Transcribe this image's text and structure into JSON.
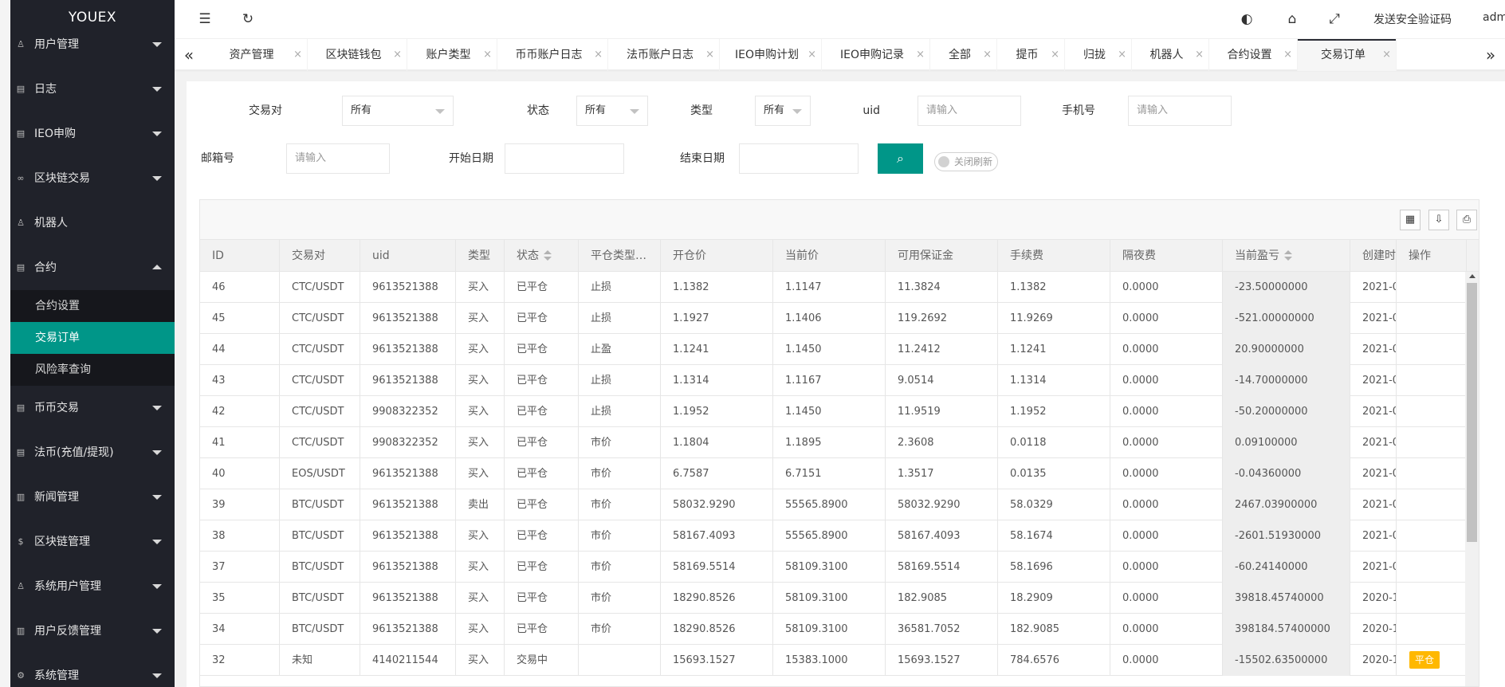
{
  "sidebar": {
    "logo": "YOUEX",
    "items": [
      {
        "label": "用户管理",
        "icon": "user-icon",
        "glyph": "♙",
        "caret": "down"
      },
      {
        "label": "日志",
        "icon": "log-icon",
        "glyph": "▤",
        "caret": "down"
      },
      {
        "label": "IEO申购",
        "icon": "ieo-icon",
        "glyph": "▤",
        "caret": "down"
      },
      {
        "label": "区块链交易",
        "icon": "link-icon",
        "glyph": "∞",
        "caret": "down"
      },
      {
        "label": "机器人",
        "icon": "robot-icon",
        "glyph": "♙",
        "caret": "none"
      },
      {
        "label": "合约",
        "icon": "contract-icon",
        "glyph": "▤",
        "caret": "up"
      }
    ],
    "sub_items": [
      {
        "label": "合约设置",
        "active": false
      },
      {
        "label": "交易订单",
        "active": true
      },
      {
        "label": "风险率查询",
        "active": false
      }
    ],
    "items_after": [
      {
        "label": "币币交易",
        "icon": "coin-icon",
        "glyph": "▤",
        "caret": "down"
      },
      {
        "label": "法币(充值/提现)",
        "icon": "fiat-icon",
        "glyph": "▤",
        "caret": "down"
      },
      {
        "label": "新闻管理",
        "icon": "news-icon",
        "glyph": "▥",
        "caret": "down"
      },
      {
        "label": "区块链管理",
        "icon": "chain-icon",
        "glyph": "$",
        "caret": "down"
      },
      {
        "label": "系统用户管理",
        "icon": "sysuser-icon",
        "glyph": "♙",
        "caret": "down"
      },
      {
        "label": "用户反馈管理",
        "icon": "feedback-icon",
        "glyph": "▥",
        "caret": "down"
      },
      {
        "label": "系统管理",
        "icon": "settings-icon",
        "glyph": "⚙",
        "caret": "down"
      }
    ]
  },
  "header": {
    "menu_icon": "☰",
    "refresh_icon": "↻",
    "theme_icon": "◐",
    "tag_icon": "⌂",
    "fullscreen_icon": "⤢",
    "send_code_label": "发送安全验证码",
    "user_label": "admin"
  },
  "tabs": {
    "prev_glyph": "«",
    "next_glyph": "»",
    "close_glyph": "×",
    "items": [
      {
        "label": "资产管理",
        "active": false
      },
      {
        "label": "区块链钱包",
        "active": false
      },
      {
        "label": "账户类型",
        "active": false
      },
      {
        "label": "币币账户日志",
        "active": false
      },
      {
        "label": "法币账户日志",
        "active": false
      },
      {
        "label": "IEO申购计划",
        "active": false
      },
      {
        "label": "IEO申购记录",
        "active": false
      },
      {
        "label": "全部",
        "active": false
      },
      {
        "label": "提币",
        "active": false
      },
      {
        "label": "归拢",
        "active": false
      },
      {
        "label": "机器人",
        "active": false
      },
      {
        "label": "合约设置",
        "active": false
      },
      {
        "label": "交易订单",
        "active": true
      }
    ]
  },
  "filters": {
    "pair_label": "交易对",
    "pair_value": "所有",
    "status_label": "状态",
    "status_value": "所有",
    "type_label": "类型",
    "type_value": "所有",
    "uid_label": "uid",
    "uid_placeholder": "请输入",
    "phone_label": "手机号",
    "phone_placeholder": "请输入",
    "email_label": "邮箱号",
    "email_placeholder": "请输入",
    "start_label": "开始日期",
    "end_label": "结束日期",
    "search_glyph": "⌕",
    "refresh_switch_label": "关闭刷新"
  },
  "toolbar": {
    "columns_glyph": "▦",
    "export_glyph": "⇩",
    "print_glyph": "⎙"
  },
  "table": {
    "columns": [
      {
        "label": "ID",
        "sortable": false
      },
      {
        "label": "交易对",
        "sortable": false
      },
      {
        "label": "uid",
        "sortable": false
      },
      {
        "label": "类型",
        "sortable": false
      },
      {
        "label": "状态",
        "sortable": true
      },
      {
        "label": "平仓类型…",
        "sortable": false
      },
      {
        "label": "开仓价",
        "sortable": false
      },
      {
        "label": "当前价",
        "sortable": false
      },
      {
        "label": "可用保证金",
        "sortable": false
      },
      {
        "label": "手续费",
        "sortable": false
      },
      {
        "label": "隔夜费",
        "sortable": false
      },
      {
        "label": "当前盈亏",
        "sortable": true
      },
      {
        "label": "创建时间",
        "sortable": false
      },
      {
        "label": "操作",
        "sortable": false
      }
    ],
    "action_label": "平仓",
    "rows": [
      [
        "46",
        "CTC/USDT",
        "9613521388",
        "买入",
        "已平仓",
        "止损",
        "1.1382",
        "1.1147",
        "11.3824",
        "1.1382",
        "0.0000",
        "-23.50000000",
        "2021-0",
        ""
      ],
      [
        "45",
        "CTC/USDT",
        "9613521388",
        "买入",
        "已平仓",
        "止损",
        "1.1927",
        "1.1406",
        "119.2692",
        "11.9269",
        "0.0000",
        "-521.00000000",
        "2021-0",
        ""
      ],
      [
        "44",
        "CTC/USDT",
        "9613521388",
        "买入",
        "已平仓",
        "止盈",
        "1.1241",
        "1.1450",
        "11.2412",
        "1.1241",
        "0.0000",
        "20.90000000",
        "2021-0",
        ""
      ],
      [
        "43",
        "CTC/USDT",
        "9613521388",
        "买入",
        "已平仓",
        "止损",
        "1.1314",
        "1.1167",
        "9.0514",
        "1.1314",
        "0.0000",
        "-14.70000000",
        "2021-0",
        ""
      ],
      [
        "42",
        "CTC/USDT",
        "9908322352",
        "买入",
        "已平仓",
        "止损",
        "1.1952",
        "1.1450",
        "11.9519",
        "1.1952",
        "0.0000",
        "-50.20000000",
        "2021-0",
        ""
      ],
      [
        "41",
        "CTC/USDT",
        "9908322352",
        "买入",
        "已平仓",
        "市价",
        "1.1804",
        "1.1895",
        "2.3608",
        "0.0118",
        "0.0000",
        "0.09100000",
        "2021-0",
        ""
      ],
      [
        "40",
        "EOS/USDT",
        "9613521388",
        "买入",
        "已平仓",
        "市价",
        "6.7587",
        "6.7151",
        "1.3517",
        "0.0135",
        "0.0000",
        "-0.04360000",
        "2021-0",
        ""
      ],
      [
        "39",
        "BTC/USDT",
        "9613521388",
        "卖出",
        "已平仓",
        "市价",
        "58032.9290",
        "55565.8900",
        "58032.9290",
        "58.0329",
        "0.0000",
        "2467.03900000",
        "2021-0",
        ""
      ],
      [
        "38",
        "BTC/USDT",
        "9613521388",
        "买入",
        "已平仓",
        "市价",
        "58167.4093",
        "55565.8900",
        "58167.4093",
        "58.1674",
        "0.0000",
        "-2601.51930000",
        "2021-0",
        ""
      ],
      [
        "37",
        "BTC/USDT",
        "9613521388",
        "买入",
        "已平仓",
        "市价",
        "58169.5514",
        "58109.3100",
        "58169.5514",
        "58.1696",
        "0.0000",
        "-60.24140000",
        "2021-0",
        ""
      ],
      [
        "35",
        "BTC/USDT",
        "9613521388",
        "买入",
        "已平仓",
        "市价",
        "18290.8526",
        "58109.3100",
        "182.9085",
        "18.2909",
        "0.0000",
        "39818.45740000",
        "2020-1",
        ""
      ],
      [
        "34",
        "BTC/USDT",
        "9613521388",
        "买入",
        "已平仓",
        "市价",
        "18290.8526",
        "58109.3100",
        "36581.7052",
        "182.9085",
        "0.0000",
        "398184.57400000",
        "2020-1",
        ""
      ],
      [
        "32",
        "未知",
        "4140211544",
        "买入",
        "交易中",
        "",
        "15693.1527",
        "15383.1000",
        "15693.1527",
        "784.6576",
        "0.0000",
        "-15502.63500000",
        "2020-1",
        "平仓"
      ]
    ]
  }
}
